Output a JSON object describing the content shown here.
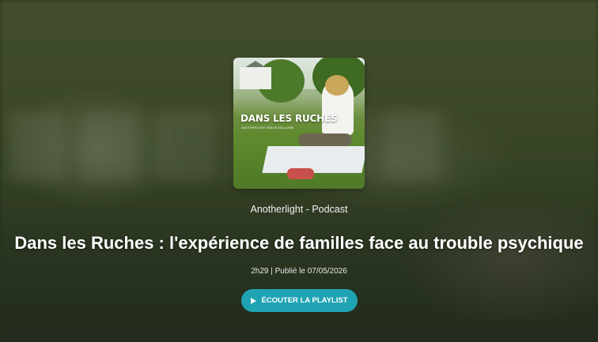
{
  "podcast": {
    "cover": {
      "title": "DANS LES RUCHES",
      "subtitle": "ANOTHERLIGHT ÉMILIE MALLORIE"
    },
    "channel": "Anotherlight - Podcast",
    "title": "Dans les Ruches : l'expérience de familles face au trouble psychique",
    "meta": "2h29 | Publié le 07/05/2026",
    "play_label": "ÉCOUTER LA PLAYLIST"
  },
  "colors": {
    "accent": "#1fa3b3"
  },
  "icons": {
    "play": "play-icon"
  }
}
